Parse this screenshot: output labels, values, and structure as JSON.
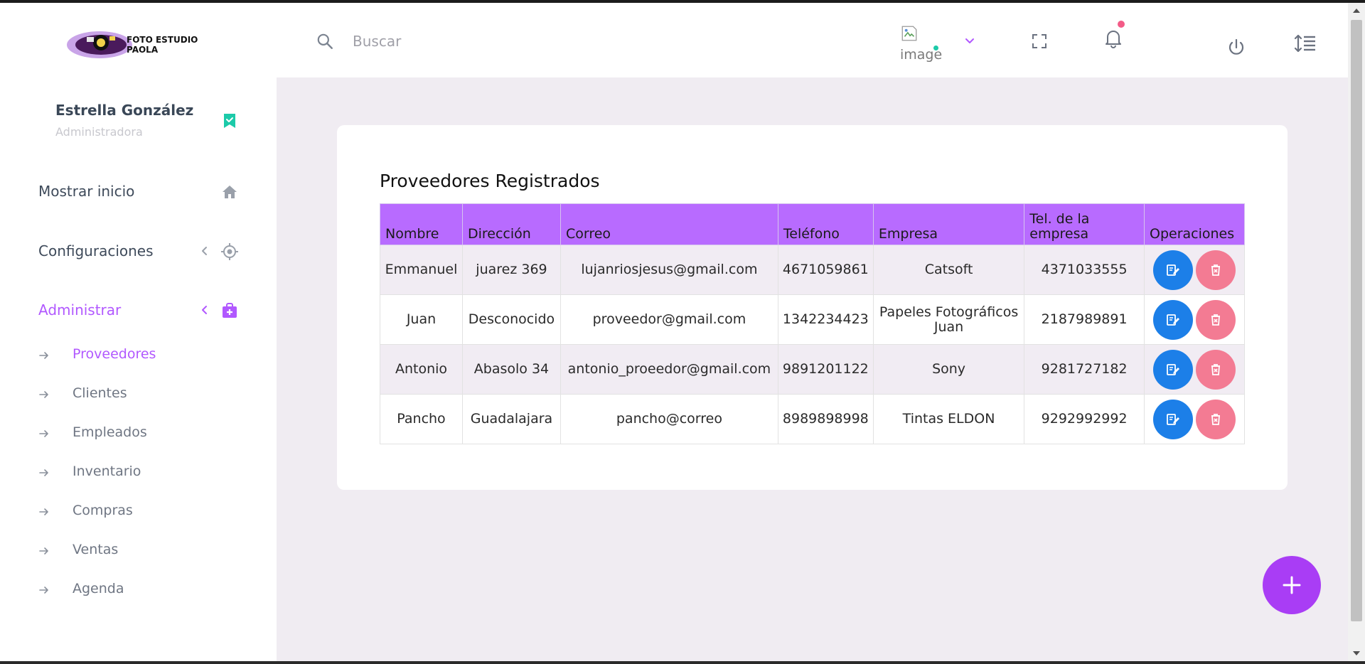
{
  "header": {
    "search_placeholder": "Buscar",
    "profile_image_alt": "image",
    "logo_text_line1": "FOTO ESTUDIO",
    "logo_text_line2": "PAOLA"
  },
  "user": {
    "name": "Estrella González",
    "role": "Administradora"
  },
  "nav": [
    {
      "label": "Mostrar inicio",
      "icon": "home-icon"
    },
    {
      "label": "Configuraciones",
      "icon": "target-icon"
    },
    {
      "label": "Administrar",
      "icon": "briefcase-plus-icon",
      "active": true
    }
  ],
  "subnav": [
    {
      "label": "Proveedores",
      "active": true
    },
    {
      "label": "Clientes"
    },
    {
      "label": "Empleados"
    },
    {
      "label": "Inventario"
    },
    {
      "label": "Compras"
    },
    {
      "label": "Ventas"
    },
    {
      "label": "Agenda"
    }
  ],
  "card": {
    "title": "Proveedores Registrados"
  },
  "table": {
    "headers": [
      "Nombre",
      "Dirección",
      "Correo",
      "Teléfono",
      "Empresa",
      "Tel. de la empresa",
      "Operaciones"
    ],
    "rows": [
      [
        "Emmanuel",
        "juarez 369",
        "lujanriosjesus@gmail.com",
        "4671059861",
        "Catsoft",
        "4371033555"
      ],
      [
        "Juan",
        "Desconocido",
        "proveedor@gmail.com",
        "1342234423",
        "Papeles Fotográficos Juan",
        "2187989891"
      ],
      [
        "Antonio",
        "Abasolo 34",
        "antonio_proeedor@gmail.com",
        "9891201122",
        "Sony",
        "9281727182"
      ],
      [
        "Pancho",
        "Guadalajara",
        "pancho@correo",
        "8989898998",
        "Tintas ELDON",
        "9292992992"
      ]
    ]
  },
  "colors": {
    "accent": "#b158ff",
    "header_bg": "#b86bff",
    "edit_button": "#1c7fe8",
    "delete_button": "#f37b93",
    "fab": "#a93df5",
    "online": "#1ccaa9",
    "notification": "#f35b87",
    "bookmark": "#1ccaa9"
  }
}
